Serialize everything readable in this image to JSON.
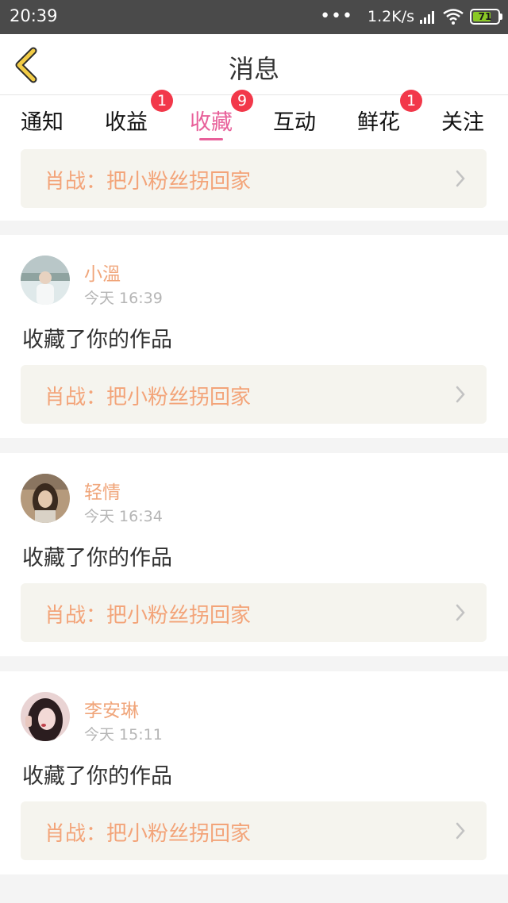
{
  "status_bar": {
    "time": "20:39",
    "dots": "•••",
    "net_speed": "1.2K/s",
    "battery": "71",
    "battery_color": "#8ac926"
  },
  "header": {
    "back_icon": "back-chevron-icon",
    "title": "消息",
    "back_color": "#f2cc46"
  },
  "tabs": [
    {
      "label": "通知",
      "badge": ""
    },
    {
      "label": "收益",
      "badge": "1"
    },
    {
      "label": "收藏",
      "badge": "9",
      "active": true
    },
    {
      "label": "互动",
      "badge": ""
    },
    {
      "label": "鲜花",
      "badge": "1"
    },
    {
      "label": "关注",
      "badge": ""
    }
  ],
  "accent_color": "#e8609a",
  "badge_color": "#f2384a",
  "partial_top_item": {
    "work": "肖战：把小粉丝拐回家"
  },
  "messages": [
    {
      "user": "小溫",
      "time": "今天 16:39",
      "action": "收藏了你的作品",
      "work": "肖战：把小粉丝拐回家"
    },
    {
      "user": "轻情",
      "time": "今天 16:34",
      "action": "收藏了你的作品",
      "work": "肖战：把小粉丝拐回家"
    },
    {
      "user": "李安琳",
      "time": "今天 15:11",
      "action": "收藏了你的作品",
      "work": "肖战：把小粉丝拐回家"
    }
  ]
}
